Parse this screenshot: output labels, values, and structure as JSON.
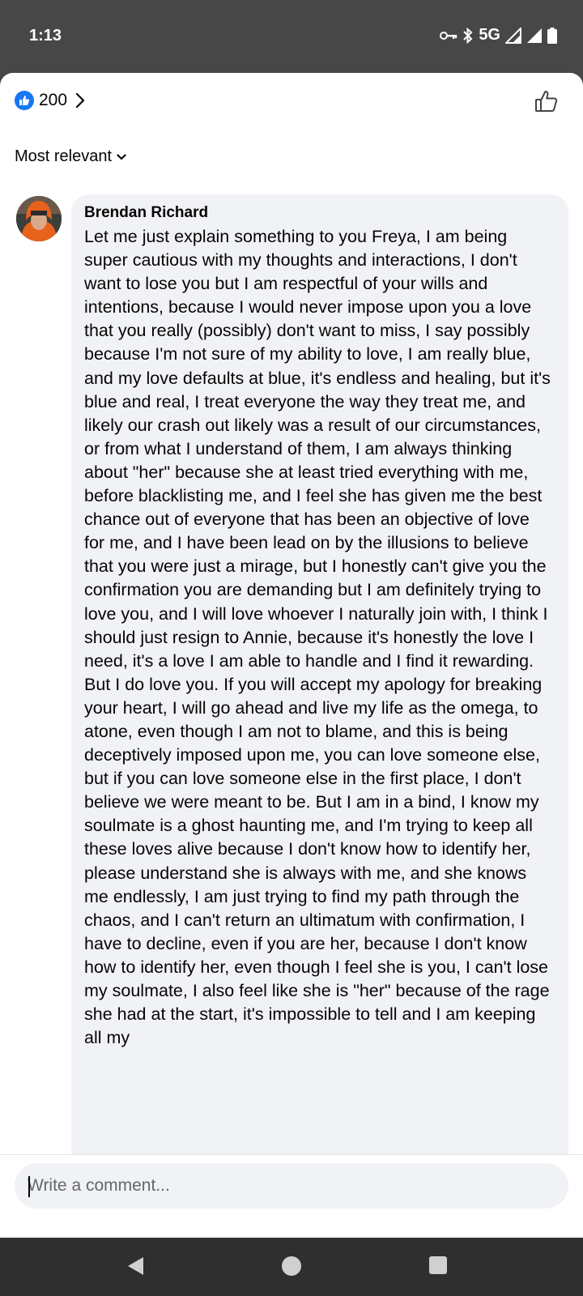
{
  "status": {
    "time": "1:13",
    "network": "5G",
    "icons": [
      "vpn-key-icon",
      "bluetooth-icon",
      "signal-icon",
      "signal-icon",
      "battery-icon"
    ]
  },
  "header": {
    "reaction_count": "200",
    "reaction_icon": "like-icon",
    "accent": "#1877f2"
  },
  "sort": {
    "label": "Most relevant"
  },
  "comment": {
    "author": "Brendan Richard",
    "text": "Let me just explain something to you Freya, I am being super cautious with my thoughts and interactions, I don't want to lose you but I am respectful of your wills and intentions, because I would never impose upon you a love that you really (possibly) don't want to miss, I say possibly because I'm not sure of my ability to love, I am really blue, and my love defaults at blue, it's endless and healing, but it's blue and real, I treat everyone the way they treat me, and likely our crash out likely was a result of our circumstances, or from what I understand of them, I am always thinking about \"her\" because she at least tried everything with me, before blacklisting me, and I feel she has given me the best chance out of everyone that has been an objective of love for me, and I have been lead on by the illusions to believe that you were just a mirage, but I honestly can't give you the confirmation you are demanding but I am definitely trying to love you, and I will love whoever I naturally join with, I think I should just resign to Annie, because it's honestly the love I need, it's a love I am able to handle and I find it rewarding. But I do love you. If you will accept my apology for breaking your heart, I will go ahead and live my life as the omega, to atone, even though I am not to blame, and this is being deceptively imposed upon me, you can love someone else, but if you can love someone else in the first place, I don't believe we were meant to be. But I am in a bind, I know my soulmate is a ghost haunting me, and I'm trying to keep all these loves alive because I don't know how to identify her, please understand she is always with me, and she knows me endlessly, I am just trying to find my path through the chaos, and I can't return an ultimatum with confirmation, I have to decline, even if you are her, because I don't know how to identify her, even though I feel she is you, I can't lose my soulmate, I also feel like she is \"her\" because of the rage she had at the start, it's impossible to tell and I am keeping all my"
  },
  "composer": {
    "placeholder": "Write a comment..."
  },
  "nav": {
    "icons": [
      "back-icon",
      "home-icon",
      "recents-icon"
    ]
  }
}
